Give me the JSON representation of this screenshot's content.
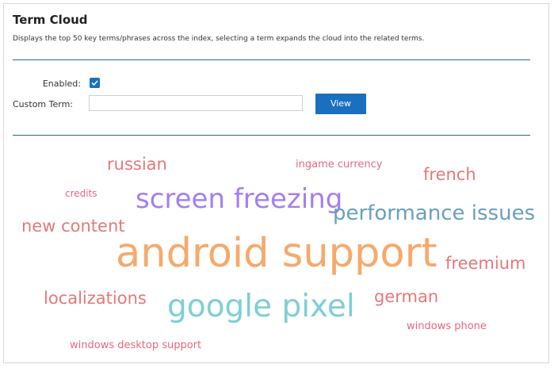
{
  "header": {
    "title": "Term Cloud",
    "description": "Displays the top 50 key terms/phrases across the index, selecting a term expands the cloud into the related terms."
  },
  "form": {
    "enabled_label": "Enabled:",
    "enabled_checked": true,
    "custom_term_label": "Custom Term:",
    "custom_term_value": "",
    "custom_term_placeholder": "",
    "view_button_label": "View"
  },
  "colors": {
    "accent": "#1a6fbf",
    "rule": "#1e6e8c",
    "pink": "#e8677f",
    "salmon": "#e5787a",
    "purple": "#a57ef2",
    "steel_blue": "#6a9fbe",
    "orange": "#f7a96a",
    "teal": "#7fcfd2"
  },
  "cloud": {
    "terms": [
      {
        "text": "russian",
        "color": "#e5787a"
      },
      {
        "text": "ingame currency",
        "color": "#e8677f"
      },
      {
        "text": "french",
        "color": "#e5787a"
      },
      {
        "text": "credits",
        "color": "#e8677f"
      },
      {
        "text": "screen freezing",
        "color": "#a57ef2"
      },
      {
        "text": "performance issues",
        "color": "#6a9fbe"
      },
      {
        "text": "new content",
        "color": "#e5787a"
      },
      {
        "text": "android support",
        "color": "#f7a96a"
      },
      {
        "text": "freemium",
        "color": "#e5787a"
      },
      {
        "text": "localizations",
        "color": "#e5787a"
      },
      {
        "text": "google pixel",
        "color": "#7fcfd2"
      },
      {
        "text": "german",
        "color": "#e5787a"
      },
      {
        "text": "windows phone",
        "color": "#e8677f"
      },
      {
        "text": "windows desktop support",
        "color": "#e8677f"
      }
    ]
  }
}
